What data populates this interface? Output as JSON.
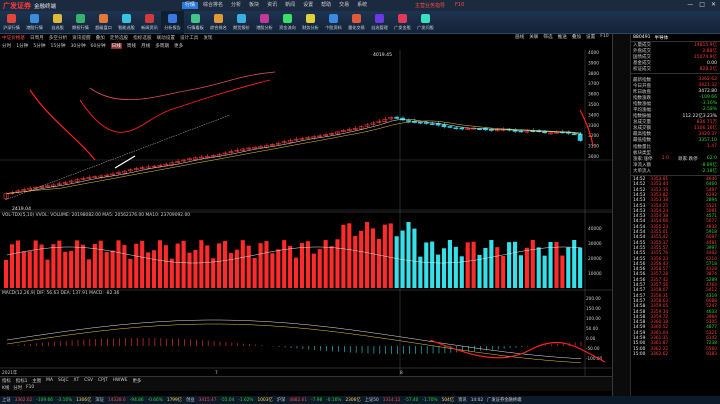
{
  "app": {
    "logo": "广发证券",
    "logo_sub": "金融终端",
    "menu": [
      "行情",
      "综合排名",
      "分析",
      "板块",
      "资讯",
      "新闻",
      "设置",
      "帮助",
      "交易",
      "系统"
    ],
    "menu_active": 0,
    "right_links": [
      "主营业务指导",
      "F10"
    ],
    "window_controls": [
      "—",
      "□",
      "✕"
    ]
  },
  "toolbar": [
    {
      "label": "沪深行情",
      "color": "#e0463a"
    },
    {
      "label": "港股行情",
      "color": "#3b8ddc"
    },
    {
      "label": "自选股",
      "color": "#e0b93a"
    },
    {
      "label": "期权行情",
      "color": "#38b26a"
    },
    {
      "label": "超级盘口",
      "color": "#e07a3a"
    },
    {
      "label": "智能选股",
      "color": "#3ac0e0"
    },
    {
      "label": "新闻资讯",
      "color": "#d03a3a"
    },
    {
      "label": "分析报告",
      "color": "#3a7ae0",
      "selected": true
    },
    {
      "label": "行情看板",
      "color": "#44c48a"
    },
    {
      "label": "综合排名",
      "color": "#e09a3a"
    },
    {
      "label": "期货报价",
      "color": "#3ab0e0"
    },
    {
      "label": "港股分析",
      "color": "#c03a9a"
    },
    {
      "label": "资金流向",
      "color": "#3ae06a"
    },
    {
      "label": "财务分析",
      "color": "#e0d03a"
    },
    {
      "label": "个股资料",
      "color": "#3a8ae0"
    },
    {
      "label": "量化交易",
      "color": "#e05a3a"
    },
    {
      "label": "自选管理",
      "color": "#6a3ae0"
    },
    {
      "label": "广发金股",
      "color": "#e03a5a"
    },
    {
      "label": "广发问股",
      "color": "#3ae0c0"
    }
  ],
  "status_strip": {
    "items": [
      "中证价格基",
      "日周月",
      "多空分析",
      "资讯提醒",
      "叠加",
      "走势选股",
      "指标选股",
      "联动设置",
      "设计工具",
      "发现"
    ],
    "right_items": [
      "画线",
      "关联",
      "筛选",
      "推送",
      "叠加",
      "设置",
      "F10",
      "大盘"
    ]
  },
  "periods": {
    "items": [
      "分时",
      "1分钟",
      "5分钟",
      "15分钟",
      "30分钟",
      "60分钟",
      "日线",
      "周线",
      "月线",
      "多周期",
      "更多"
    ],
    "active": 6
  },
  "price_chart": {
    "high_label": "4019.45",
    "low_label": "2419.04",
    "axis_ticks": [
      "4000",
      "3900",
      "3800",
      "3700",
      "3600",
      "3500",
      "3400",
      "3300",
      "3200",
      "3100",
      "3000"
    ]
  },
  "volume_bar": {
    "text": "VOL-TDX(5,10) VVOL: VOLUME: 20198082.00 MA5: 20562376.00 MA10: 23709092.00",
    "axis_ticks": [
      "40000",
      "30000",
      "20000",
      "10000"
    ]
  },
  "macd_bar": {
    "text": "MACD(12,26,9) DIF: 56.63 DEA: 137.91 MACD: -82.36",
    "axis_ticks": [
      "200.00",
      "150.00",
      "100.00",
      "50.00",
      "0.00",
      "-50.00",
      "-100.00"
    ],
    "x_labels": [
      "2021年",
      "7",
      "8"
    ]
  },
  "bottom_tabs": [
    "指标",
    "指标1",
    "主图",
    "MA",
    "SGJC",
    "XT",
    "CSV",
    "CPJT",
    "HWWE",
    "更多"
  ],
  "bottom_tabs2": [
    "K线",
    "分时",
    "F10"
  ],
  "sidebar": {
    "code": "880491",
    "name": "半导体",
    "rows": [
      {
        "k": "入量成交",
        "v": "14815.9亿",
        "c": "red"
      },
      {
        "k": "外盘成交",
        "v": "2.88亿",
        "c": "red"
      },
      {
        "k": "国债成交",
        "v": "15074.9亿",
        "c": "red"
      },
      {
        "k": "基金成交",
        "v": "0.00",
        "c": "white"
      },
      {
        "k": "权证成交",
        "v": "828.2亿",
        "c": "red"
      }
    ],
    "rows2": [
      {
        "k": "最新指数",
        "v": "3362.62",
        "c": "red"
      },
      {
        "k": "今日开盘",
        "v": "3421.32",
        "c": "red"
      },
      {
        "k": "昨日收盘",
        "v": "3472.80",
        "c": "white"
      },
      {
        "k": "指数涨跌",
        "v": "-109.66",
        "c": "green"
      },
      {
        "k": "指数涨幅",
        "v": "-3.16%",
        "c": "green"
      },
      {
        "k": "平均涨幅",
        "v": "-2.58%",
        "c": "green"
      },
      {
        "k": "指数振幅",
        "v": "112.22亿3.23%",
        "c": "white"
      },
      {
        "k": "总成交量",
        "v": "836.71万",
        "c": "red"
      },
      {
        "k": "总成交额",
        "v": "1306.16亿",
        "c": "red"
      },
      {
        "k": "最高指数",
        "v": "3429.37",
        "c": "red"
      },
      {
        "k": "最低指数",
        "v": "3357.10",
        "c": "green"
      },
      {
        "k": "指数量比",
        "v": "1.47",
        "c": "red"
      },
      {
        "k": "板块类型",
        "v": "",
        "c": "white"
      }
    ],
    "stat_row": {
      "k": "涨家:涨停",
      "v1": "1:0",
      "m": "跌家:跌停",
      "v2": "62:0"
    },
    "rows3": [
      {
        "k": "净流入额",
        "v": "-8.89亿",
        "c": "green"
      },
      {
        "k": "大单流入",
        "v": "-2.18亿",
        "c": "green"
      }
    ],
    "ticks": [
      {
        "t": "14:52",
        "p": "3353.81",
        "v": "4646"
      },
      {
        "t": "14:52",
        "p": "3353.44",
        "v": "6460"
      },
      {
        "t": "14:52",
        "p": "3353.16",
        "v": "5497"
      },
      {
        "t": "14:53",
        "p": "3353.82",
        "v": "6292"
      },
      {
        "t": "14:53",
        "p": "3353.38",
        "v": "2894"
      },
      {
        "t": "14:53",
        "p": "3354.25",
        "v": "5521"
      },
      {
        "t": "14:53",
        "p": "3354.24",
        "v": "5081"
      },
      {
        "t": "14:53",
        "p": "3354.38",
        "v": "4571"
      },
      {
        "t": "14:54",
        "p": "3354.66",
        "v": "5677"
      },
      {
        "t": "14:54",
        "p": "3355.24",
        "v": "4832"
      },
      {
        "t": "14:54",
        "p": "3355.01",
        "v": "5918"
      },
      {
        "t": "14:54",
        "p": "3355.42",
        "v": "6097"
      },
      {
        "t": "14:55",
        "p": "3355.37",
        "v": "4481"
      },
      {
        "t": "14:55",
        "p": "3355.57",
        "v": "3997"
      },
      {
        "t": "14:55",
        "p": "3355.76",
        "v": "4402"
      },
      {
        "t": "14:55",
        "p": "3356.23",
        "v": "6210"
      },
      {
        "t": "14:56",
        "p": "3356.43",
        "v": "5718"
      },
      {
        "t": "14:56",
        "p": "3356.57",
        "v": "4128"
      },
      {
        "t": "14:56",
        "p": "3357.28",
        "v": "3874"
      },
      {
        "t": "14:56",
        "p": "3357.42",
        "v": "5289"
      },
      {
        "t": "14:57",
        "p": "3357.56",
        "v": "4764"
      },
      {
        "t": "14:57",
        "p": "3358.07",
        "v": "5412"
      },
      {
        "t": "14:57",
        "p": "3358.31",
        "v": "4319"
      },
      {
        "t": "14:57",
        "p": "3358.63",
        "v": "6088"
      },
      {
        "t": "14:58",
        "p": "3359.05",
        "v": "5247"
      },
      {
        "t": "14:58",
        "p": "3359.34",
        "v": "4633"
      },
      {
        "t": "14:58",
        "p": "3359.72",
        "v": "3984"
      },
      {
        "t": "14:58",
        "p": "3360.18",
        "v": "5105"
      },
      {
        "t": "14:59",
        "p": "3360.52",
        "v": "4877"
      },
      {
        "t": "14:59",
        "p": "3361.04",
        "v": "5321"
      },
      {
        "t": "14:59",
        "p": "3361.35",
        "v": "6142"
      },
      {
        "t": "15:00",
        "p": "3361.87",
        "v": "7238"
      },
      {
        "t": "15:00",
        "p": "3362.22",
        "v": "5560"
      },
      {
        "t": "15:00",
        "p": "3362.62",
        "v": "9183"
      }
    ]
  },
  "statusbar": [
    {
      "t": "上证",
      "c": "white"
    },
    {
      "t": "3362.62",
      "c": "r"
    },
    {
      "t": "-109.66",
      "c": "g"
    },
    {
      "t": "-3.16%",
      "c": "g"
    },
    {
      "t": "1306亿",
      "c": "y"
    },
    {
      "t": "深证",
      "c": "white"
    },
    {
      "t": "14328.6",
      "c": "r"
    },
    {
      "t": "-94.86",
      "c": "g"
    },
    {
      "t": "-0.66%",
      "c": "g"
    },
    {
      "t": "1799亿",
      "c": "y"
    },
    {
      "t": "创业",
      "c": "white"
    },
    {
      "t": "3415.47",
      "c": "r"
    },
    {
      "t": "-55.04",
      "c": "g"
    },
    {
      "t": "-1.62%",
      "c": "g"
    },
    {
      "t": "1003亿",
      "c": "y"
    },
    {
      "t": "沪深",
      "c": "white"
    },
    {
      "t": "4882.61",
      "c": "r"
    },
    {
      "t": "-7.98",
      "c": "g"
    },
    {
      "t": "-0.16%",
      "c": "g"
    },
    {
      "t": "2306亿",
      "c": "y"
    },
    {
      "t": "上证50",
      "c": "white"
    },
    {
      "t": "3314.12",
      "c": "r"
    },
    {
      "t": "-57.40",
      "c": "g"
    },
    {
      "t": "-1.70%",
      "c": "g"
    },
    {
      "t": "504亿",
      "c": "y"
    },
    {
      "t": "资讯",
      "c": "white"
    },
    {
      "t": "14:02",
      "c": "white"
    },
    {
      "t": "广发证券金融终端",
      "c": "white"
    }
  ]
}
